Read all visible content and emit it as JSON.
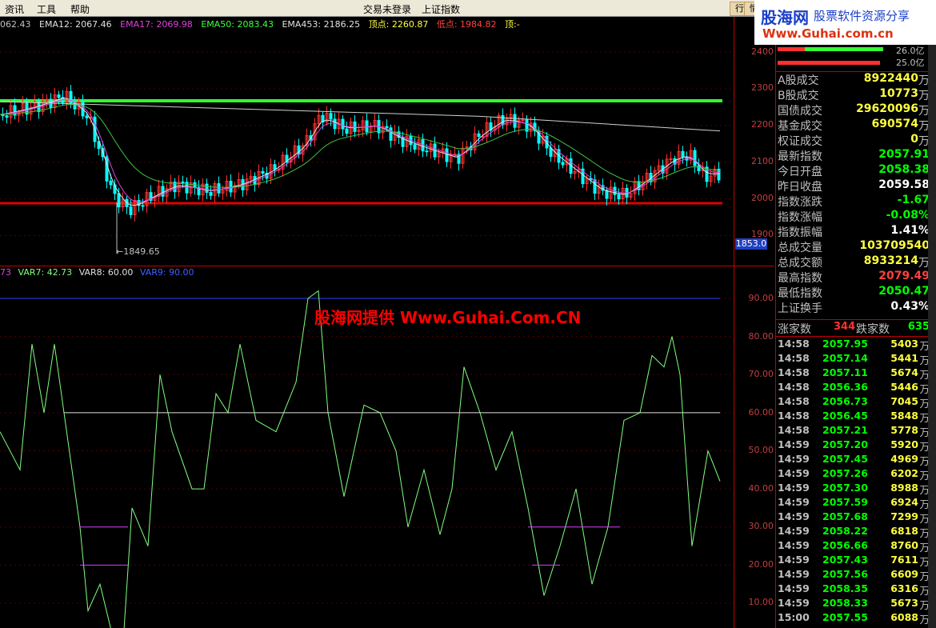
{
  "menu": {
    "items": [
      "资讯",
      "工具",
      "帮助"
    ],
    "center_items": [
      "交易未登录",
      "上证指数"
    ],
    "right_buttons": [
      "行",
      "情"
    ]
  },
  "banner": {
    "title": "股海网",
    "subtitle": "股票软件资源分享",
    "url": "Www.Guhai.com.cn"
  },
  "chart_header": {
    "fields": [
      "062.43",
      "EMA12: 2067.46",
      "EMA17: 2069.98",
      "EMA50: 2083.43",
      "EMA453: 2186.25",
      "顶点: 2260.87",
      "低点: 1984.82",
      "顶:-"
    ]
  },
  "indicator_header": {
    "fields": [
      "73",
      "VAR7: 42.73",
      "VAR8: 60.00",
      "VAR9: 90.00"
    ]
  },
  "watermark": "股海网提供 Www.Guhai.Com.CN",
  "low_annotation": "1849.65",
  "price_badge": "1853.0",
  "price_axis": [
    "2400",
    "2300",
    "2200",
    "2100",
    "2000",
    "1900"
  ],
  "indicator_axis": [
    "90.00",
    "80.00",
    "70.00",
    "60.00",
    "50.00",
    "40.00",
    "30.00",
    "20.00",
    "10.00"
  ],
  "volume_bars": [
    {
      "value": "26.0亿"
    },
    {
      "value": "25.0亿"
    }
  ],
  "stats": [
    {
      "label": "A股成交",
      "value": "8922440",
      "unit": "万"
    },
    {
      "label": "B股成交",
      "value": "10773",
      "unit": "万"
    },
    {
      "label": "国债成交",
      "value": "29620096",
      "unit": "万"
    },
    {
      "label": "基金成交",
      "value": "690574",
      "unit": "万"
    },
    {
      "label": "权证成交",
      "value": "0",
      "unit": "万"
    },
    {
      "label": "最新指数",
      "value": "2057.91",
      "color": "#00ff00"
    },
    {
      "label": "今日开盘",
      "value": "2058.38",
      "color": "#00ff00"
    },
    {
      "label": "昨日收盘",
      "value": "2059.58",
      "color": "#ffffff"
    },
    {
      "label": "指数涨跌",
      "value": "-1.67",
      "color": "#00ff00"
    },
    {
      "label": "指数涨幅",
      "value": "-0.08%",
      "color": "#00ff00"
    },
    {
      "label": "指数振幅",
      "value": "1.41%",
      "color": "#ffffff"
    },
    {
      "label": "总成交量",
      "value": "103709540",
      "color": "#ffff40"
    },
    {
      "label": "总成交额",
      "value": "8933214",
      "unit": "万"
    },
    {
      "label": "最高指数",
      "value": "2079.49",
      "color": "#ff4040"
    },
    {
      "label": "最低指数",
      "value": "2050.47",
      "color": "#00ff00"
    },
    {
      "label": "上证换手",
      "value": "0.43%",
      "color": "#ffffff"
    }
  ],
  "updown": {
    "up_label": "涨家数",
    "up": "344",
    "down_label": "跌家数",
    "down": "635"
  },
  "ticks": [
    [
      "14:58",
      "2057.95",
      "5403"
    ],
    [
      "14:58",
      "2057.14",
      "5441"
    ],
    [
      "14:58",
      "2057.11",
      "5674"
    ],
    [
      "14:58",
      "2056.36",
      "5446"
    ],
    [
      "14:58",
      "2056.73",
      "7045"
    ],
    [
      "14:58",
      "2056.45",
      "5848"
    ],
    [
      "14:58",
      "2057.21",
      "5778"
    ],
    [
      "14:59",
      "2057.20",
      "5920"
    ],
    [
      "14:59",
      "2057.45",
      "4969"
    ],
    [
      "14:59",
      "2057.26",
      "6202"
    ],
    [
      "14:59",
      "2057.30",
      "8988"
    ],
    [
      "14:59",
      "2057.59",
      "6924"
    ],
    [
      "14:59",
      "2057.68",
      "7299"
    ],
    [
      "14:59",
      "2058.22",
      "6818"
    ],
    [
      "14:59",
      "2056.66",
      "8760"
    ],
    [
      "14:59",
      "2057.43",
      "7611"
    ],
    [
      "14:59",
      "2057.56",
      "6609"
    ],
    [
      "14:59",
      "2058.35",
      "6316"
    ],
    [
      "14:59",
      "2058.33",
      "5673"
    ],
    [
      "15:00",
      "2057.55",
      "6088"
    ]
  ],
  "tick_unit": "万",
  "colors": {
    "up": "#ff3030",
    "down": "#00ffff",
    "support": "#e00000",
    "resistance": "#33ff33",
    "var7": "#80ff80",
    "var7_low": "#d040ff",
    "var8": "#e0e0e0",
    "var9": "#3040ff"
  }
}
